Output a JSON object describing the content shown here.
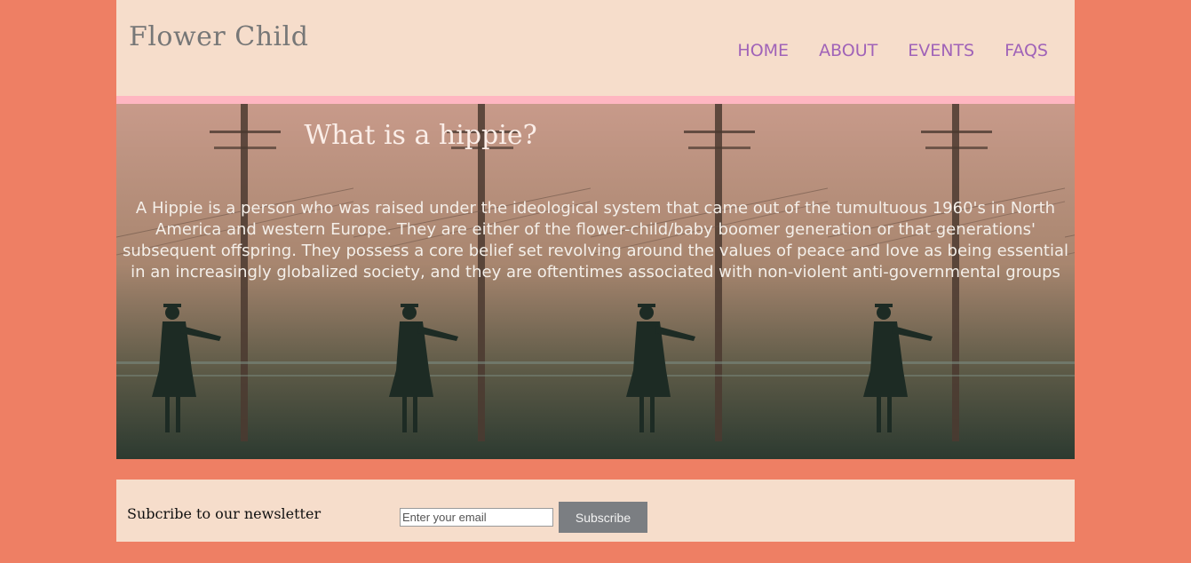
{
  "header": {
    "brand": "Flower Child",
    "nav": [
      {
        "label": "HOME"
      },
      {
        "label": "ABOUT"
      },
      {
        "label": "EVENTS"
      },
      {
        "label": "FAQS"
      }
    ]
  },
  "hero": {
    "title": "What is a hippie?",
    "text": "A Hippie is a person who was raised under the ideological system that came out of the tumultuous 1960's in North America and western Europe. They are either of the flower-child/baby boomer generation or that generations' subsequent offspring. They possess a core belief set revolving around the values of peace and love as being essential in an increasingly globalized society, and they are oftentimes associated with non-violent anti-governmental groups"
  },
  "newsletter": {
    "label": "Subcribe to our newsletter",
    "email_placeholder": "Enter your email",
    "button_label": "Subscribe"
  },
  "colors": {
    "background": "#ee7f64",
    "panel": "#f6ddcb",
    "accent_bar": "#ffb6c1",
    "nav_link": "#a063b8",
    "button": "#7b7e82"
  }
}
